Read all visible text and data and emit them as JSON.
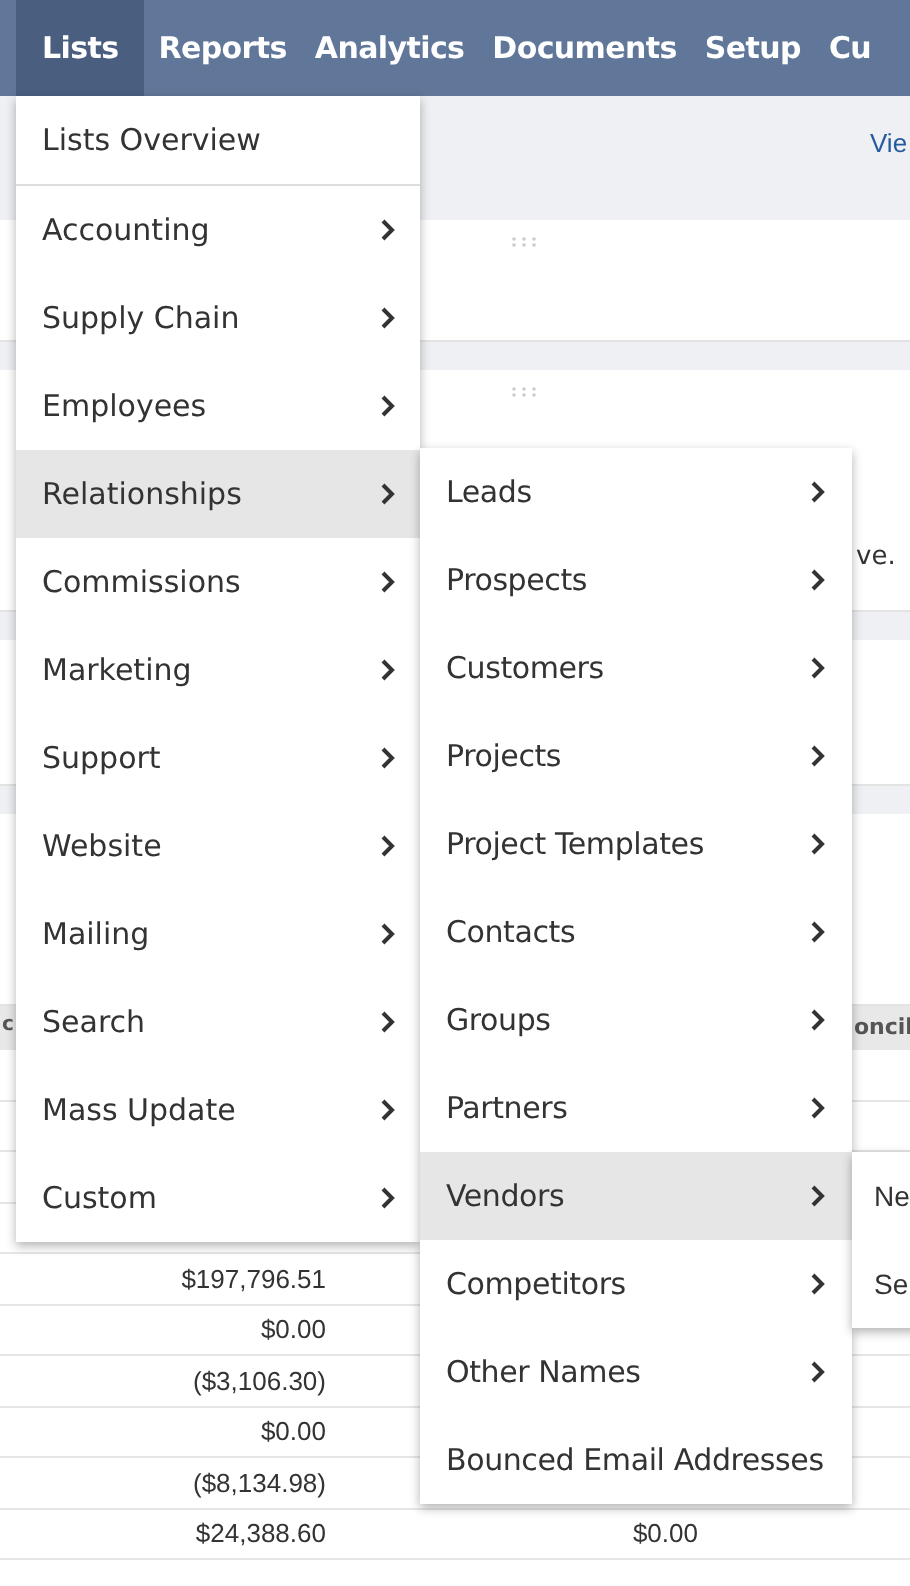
{
  "nav": {
    "items": [
      {
        "label": "Lists",
        "selected": true
      },
      {
        "label": "Reports",
        "selected": false
      },
      {
        "label": "Analytics",
        "selected": false
      },
      {
        "label": "Documents",
        "selected": false
      },
      {
        "label": "Setup",
        "selected": false
      },
      {
        "label": "Cu",
        "selected": false
      }
    ]
  },
  "subbar": {
    "link": "Vie"
  },
  "note_fragment": "ve.",
  "table": {
    "column_1": "c",
    "column_3": "oncil",
    "rows": [
      {
        "column_2": "$197,796.51",
        "column_3": ""
      },
      {
        "column_2": "$0.00",
        "column_3": ""
      },
      {
        "column_2": "($3,106.30)",
        "column_3": ""
      },
      {
        "column_2": "$0.00",
        "column_3": ""
      },
      {
        "column_2": "($8,134.98)",
        "column_3": ""
      },
      {
        "column_2": "$24,388.60",
        "column_3": "$0.00"
      }
    ]
  },
  "lists_menu": {
    "items": [
      {
        "label": "Lists Overview",
        "kind": "link",
        "selected": false
      },
      {
        "label": "Accounting",
        "kind": "submenu",
        "selected": false
      },
      {
        "label": "Supply Chain",
        "kind": "submenu",
        "selected": false
      },
      {
        "label": "Employees",
        "kind": "submenu",
        "selected": false
      },
      {
        "label": "Relationships",
        "kind": "submenu",
        "selected": true
      },
      {
        "label": "Commissions",
        "kind": "submenu",
        "selected": false
      },
      {
        "label": "Marketing",
        "kind": "submenu",
        "selected": false
      },
      {
        "label": "Support",
        "kind": "submenu",
        "selected": false
      },
      {
        "label": "Website",
        "kind": "submenu",
        "selected": false
      },
      {
        "label": "Mailing",
        "kind": "submenu",
        "selected": false
      },
      {
        "label": "Search",
        "kind": "submenu",
        "selected": false
      },
      {
        "label": "Mass Update",
        "kind": "submenu",
        "selected": false
      },
      {
        "label": "Custom",
        "kind": "submenu",
        "selected": false
      }
    ]
  },
  "relationships_menu": {
    "items": [
      {
        "label": "Leads",
        "kind": "submenu",
        "selected": false
      },
      {
        "label": "Prospects",
        "kind": "submenu",
        "selected": false
      },
      {
        "label": "Customers",
        "kind": "submenu",
        "selected": false
      },
      {
        "label": "Projects",
        "kind": "submenu",
        "selected": false
      },
      {
        "label": "Project Templates",
        "kind": "submenu",
        "selected": false
      },
      {
        "label": "Contacts",
        "kind": "submenu",
        "selected": false
      },
      {
        "label": "Groups",
        "kind": "submenu",
        "selected": false
      },
      {
        "label": "Partners",
        "kind": "submenu",
        "selected": false
      },
      {
        "label": "Vendors",
        "kind": "submenu",
        "selected": true
      },
      {
        "label": "Competitors",
        "kind": "submenu",
        "selected": false
      },
      {
        "label": "Other Names",
        "kind": "submenu",
        "selected": false
      },
      {
        "label": "Bounced Email Addresses",
        "kind": "link",
        "selected": false
      }
    ]
  },
  "vendors_menu": {
    "items": [
      {
        "label": "Ne",
        "selected": false
      },
      {
        "label": "Se",
        "selected": false
      }
    ]
  }
}
